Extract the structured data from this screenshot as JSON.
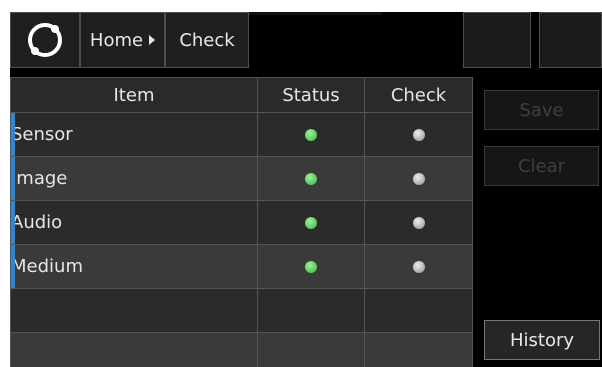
{
  "breadcrumb": {
    "home": "Home",
    "current": "Check"
  },
  "table": {
    "headers": {
      "item": "Item",
      "status": "Status",
      "check": "Check"
    },
    "rows": [
      {
        "item": "Sensor",
        "status": "green",
        "check": "gray"
      },
      {
        "item": "Image",
        "status": "green",
        "check": "gray"
      },
      {
        "item": "Audio",
        "status": "green",
        "check": "gray"
      },
      {
        "item": "Medium",
        "status": "green",
        "check": "gray"
      }
    ]
  },
  "actions": {
    "save": "Save",
    "clear": "Clear",
    "history": "History"
  },
  "colors": {
    "accent_marker": "#2e86d8",
    "status_ok": "#4fcf4f",
    "status_idle": "#aaaaaa",
    "background": "#000000"
  }
}
